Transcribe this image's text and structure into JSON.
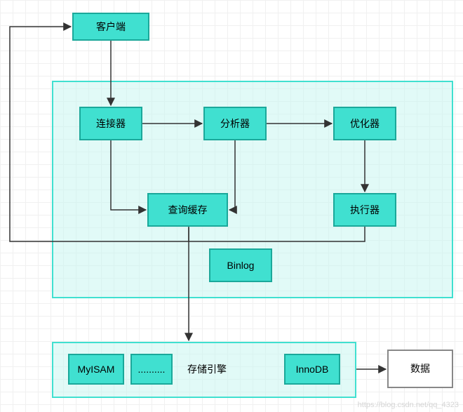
{
  "nodes": {
    "client": "客户端",
    "connector": "连接器",
    "analyzer": "分析器",
    "optimizer": "优化器",
    "queryCache": "查询缓存",
    "executor": "执行器",
    "binlog": "Binlog",
    "storageEngine": "存储引擎",
    "myisam": "MyISAM",
    "innodb": "InnoDB",
    "ellipsis": "..........",
    "data": "数据"
  },
  "colors": {
    "cyanFill": "#40E0D0",
    "cyanBorder": "#1ba89a",
    "containerFill": "rgba(200,245,240,0.55)",
    "greyBorder": "#888"
  },
  "watermark": "https://blog.csdn.net/qq_4323"
}
